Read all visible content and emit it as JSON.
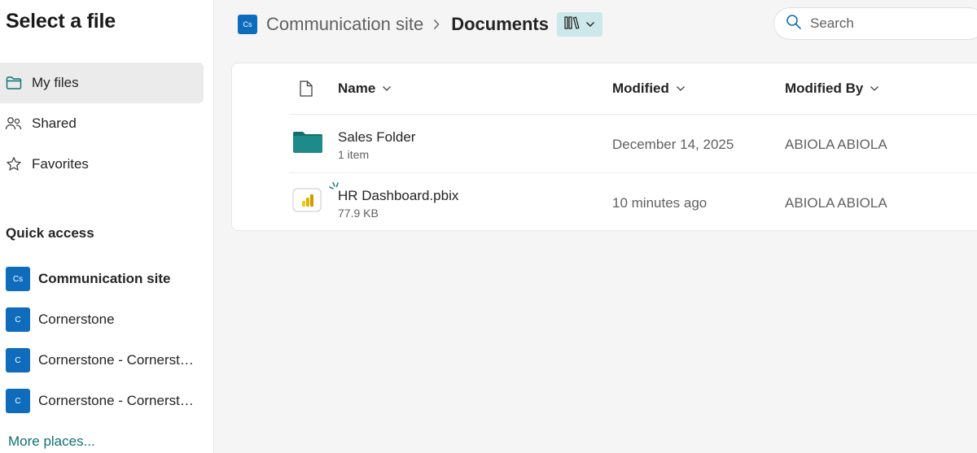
{
  "sidebar": {
    "title": "Select a file",
    "nav": [
      {
        "label": "My files",
        "icon": "folder-icon",
        "active": true
      },
      {
        "label": "Shared",
        "icon": "people-icon",
        "active": false
      },
      {
        "label": "Favorites",
        "icon": "star-icon",
        "active": false
      }
    ],
    "quick_access_title": "Quick access",
    "quick_access": [
      {
        "badge": "Cs",
        "label": "Communication site",
        "bold": true
      },
      {
        "badge": "C",
        "label": "Cornerstone",
        "bold": false
      },
      {
        "badge": "C",
        "label": "Cornerstone - Cornerstone",
        "bold": false
      },
      {
        "badge": "C",
        "label": "Cornerstone - Cornerstone",
        "bold": false
      }
    ],
    "more_places": "More places..."
  },
  "header": {
    "site_badge": "Cs",
    "site_name": "Communication site",
    "current": "Documents",
    "view_icon": "library-view-icon"
  },
  "search": {
    "placeholder": "Search"
  },
  "table": {
    "columns": {
      "name": "Name",
      "modified": "Modified",
      "modified_by": "Modified By"
    },
    "rows": [
      {
        "name": "Sales Folder",
        "meta": "1 item",
        "modified": "December 14, 2025",
        "modified_by": "ABIOLA ABIOLA",
        "icon": "folder-icon"
      },
      {
        "name": "HR Dashboard.pbix",
        "meta": "77.9 KB",
        "modified": "10 minutes ago",
        "modified_by": "ABIOLA ABIOLA",
        "icon": "powerbi-file-icon"
      }
    ]
  },
  "colors": {
    "accent": "#0f6cbd",
    "teal": "#0f6f74",
    "folder": "#1e8a8a"
  }
}
